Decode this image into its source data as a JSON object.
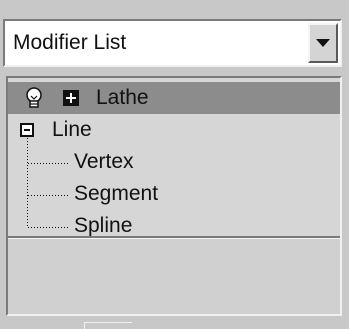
{
  "modifier_list": {
    "selected": "Modifier List",
    "dropdown_icon": "chevron-down-icon"
  },
  "stack": {
    "items": [
      {
        "label": "Lathe",
        "icon": "lightbulb-icon",
        "toggle": "plus-box-icon",
        "selected": true
      },
      {
        "label": "Line",
        "toggle": "minus-box-icon",
        "expanded": true
      },
      {
        "label": "Vertex",
        "level": "sub-object"
      },
      {
        "label": "Segment",
        "level": "sub-object"
      },
      {
        "label": "Spline",
        "level": "sub-object"
      }
    ]
  },
  "colors": {
    "panel_bg": "#c8c8c8",
    "selected_row": "#8c8c8c",
    "field_bg": "#ffffff"
  }
}
